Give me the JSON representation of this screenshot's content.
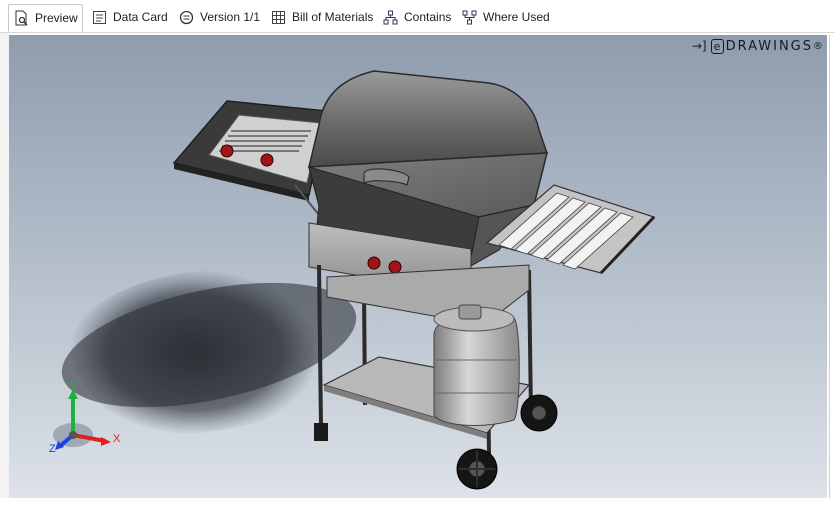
{
  "tabs": [
    {
      "label": "Preview",
      "icon": "preview-icon",
      "active": true
    },
    {
      "label": "Data Card",
      "icon": "data-card-icon",
      "active": false
    },
    {
      "label": "Version 1/1",
      "icon": "version-icon",
      "active": false
    },
    {
      "label": "Bill of Materials",
      "icon": "bill-of-materials-icon",
      "active": false
    },
    {
      "label": "Contains",
      "icon": "contains-icon",
      "active": false
    },
    {
      "label": "Where Used",
      "icon": "where-used-icon",
      "active": false
    }
  ],
  "viewer": {
    "logo_text": "DRAWINGS",
    "logo_letter": "e",
    "logo_mark": "®",
    "model": "grill-assembly",
    "triad": {
      "x": "X",
      "y": "Y",
      "z": "Z"
    },
    "colors": {
      "x_axis": "#e02020",
      "y_axis": "#20b040",
      "z_axis": "#2040e0"
    }
  }
}
